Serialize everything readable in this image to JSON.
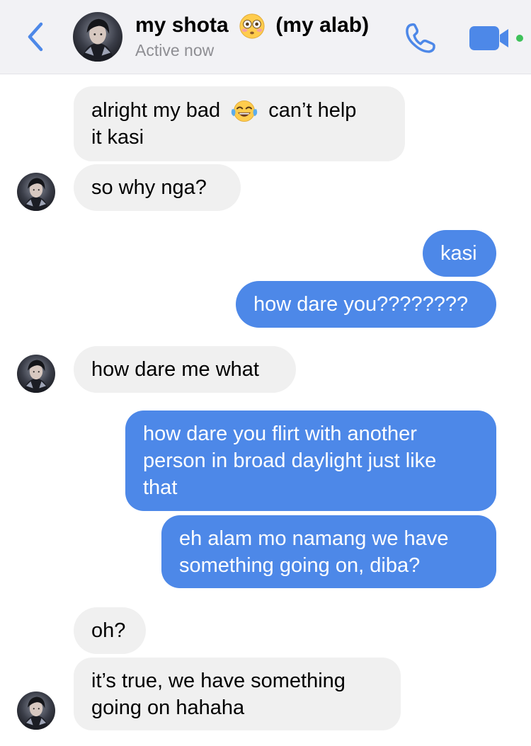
{
  "header": {
    "contact_name": "my shota",
    "contact_suffix": "(my alab)",
    "status": "Active now"
  },
  "icons": {
    "back": "chevron-left-icon",
    "call": "phone-icon",
    "video": "video-camera-icon",
    "emoji_flushed": "flushed-face-emoji",
    "emoji_laugh": "tears-of-joy-emoji",
    "accent_color": "#4d88e8",
    "incoming_bubble_color": "#f0f0f0"
  },
  "messages": [
    {
      "sender": "contact",
      "lines": [
        "alright my bad",
        "can’t help",
        "it kasi"
      ]
    },
    {
      "sender": "contact",
      "lines": [
        "so why nga?"
      ]
    },
    {
      "sender": "me",
      "lines": [
        "kasi"
      ]
    },
    {
      "sender": "me",
      "lines": [
        "how dare you????????"
      ]
    },
    {
      "sender": "contact",
      "lines": [
        "how dare me what"
      ]
    },
    {
      "sender": "me",
      "lines": [
        "how dare you flirt with another",
        "person in broad daylight just like",
        "that"
      ]
    },
    {
      "sender": "me",
      "lines": [
        "eh alam mo namang we have",
        "something going on, diba?"
      ]
    },
    {
      "sender": "contact",
      "lines": [
        "oh?"
      ]
    },
    {
      "sender": "contact",
      "lines": [
        "it’s true, we have something",
        "going on hahaha"
      ]
    }
  ]
}
